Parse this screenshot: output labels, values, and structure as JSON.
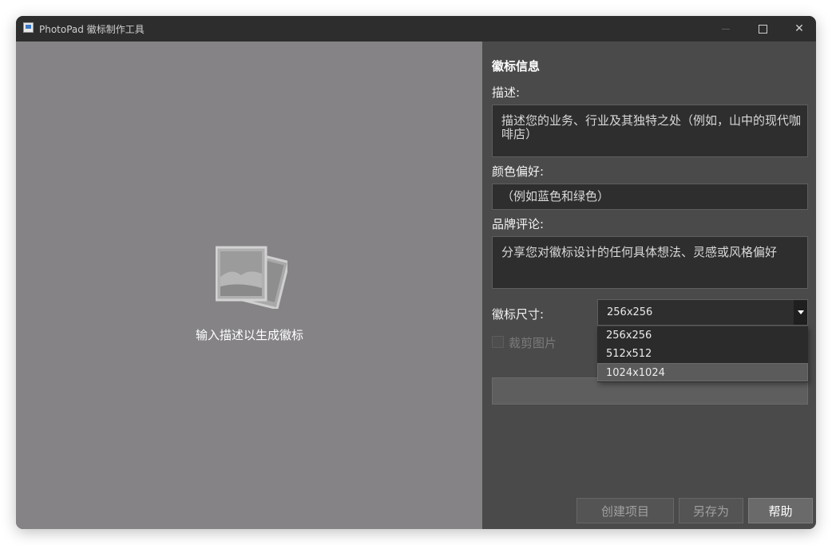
{
  "window": {
    "title": "PhotoPad 徽标制作工具"
  },
  "preview": {
    "placeholder_text": "输入描述以生成徽标",
    "placeholder_icon": "image-placeholder-icon"
  },
  "panel": {
    "section_title": "徽标信息",
    "description": {
      "label": "描述:",
      "placeholder": "描述您的业务、行业及其独特之处（例如，山中的现代咖啡店）"
    },
    "color": {
      "label": "颜色偏好:",
      "placeholder": "（例如蓝色和绿色）"
    },
    "brand": {
      "label": "品牌评论:",
      "placeholder": "分享您对徽标设计的任何具体想法、灵感或风格偏好"
    },
    "size": {
      "label": "徽标尺寸:",
      "selected": "256x256",
      "options": [
        "256x256",
        "512x512",
        "1024x1024"
      ],
      "highlighted": "1024x1024"
    },
    "crop": {
      "label": "裁剪图片",
      "checked": false
    }
  },
  "buttons": {
    "create_project": "创建项目",
    "save_as": "另存为",
    "help": "帮助"
  }
}
